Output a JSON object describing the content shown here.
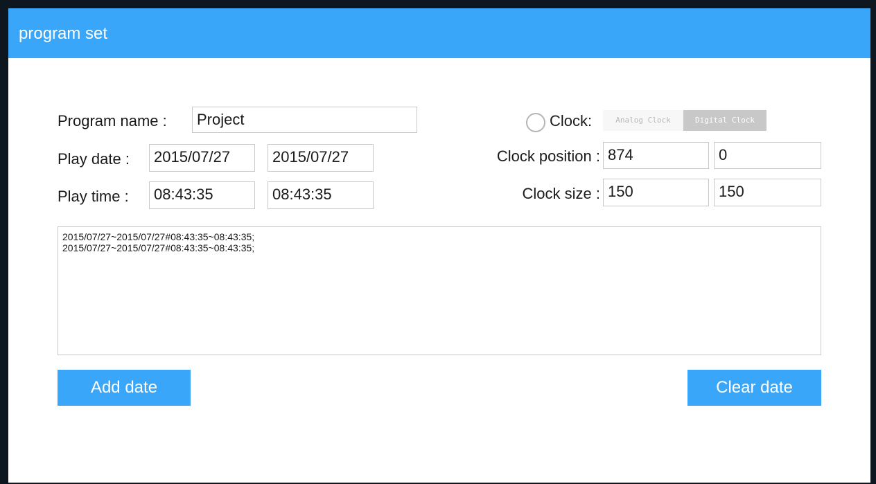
{
  "dialog": {
    "title": "program set"
  },
  "program_name": {
    "label": "Program name :",
    "value": "Project"
  },
  "play_date": {
    "label": "Play date :",
    "start": "2015/07/27",
    "end": "2015/07/27"
  },
  "play_time": {
    "label": "Play time :",
    "start": "08:43:35",
    "end": "08:43:35"
  },
  "clock": {
    "label": "Clock:",
    "selected": false,
    "options": [
      "Analog Clock",
      "Digital Clock"
    ],
    "active_option": "Digital Clock",
    "position_label": "Clock position :",
    "position_x": "874",
    "position_y": "0",
    "size_label": "Clock size :",
    "size_w": "150",
    "size_h": "150"
  },
  "schedule_list": [
    "2015/07/27~2015/07/27#08:43:35~08:43:35;",
    "2015/07/27~2015/07/27#08:43:35~08:43:35;"
  ],
  "buttons": {
    "add": "Add date",
    "clear": "Clear date"
  },
  "colors": {
    "accent": "#39a6f9",
    "background": "#0e1620"
  }
}
